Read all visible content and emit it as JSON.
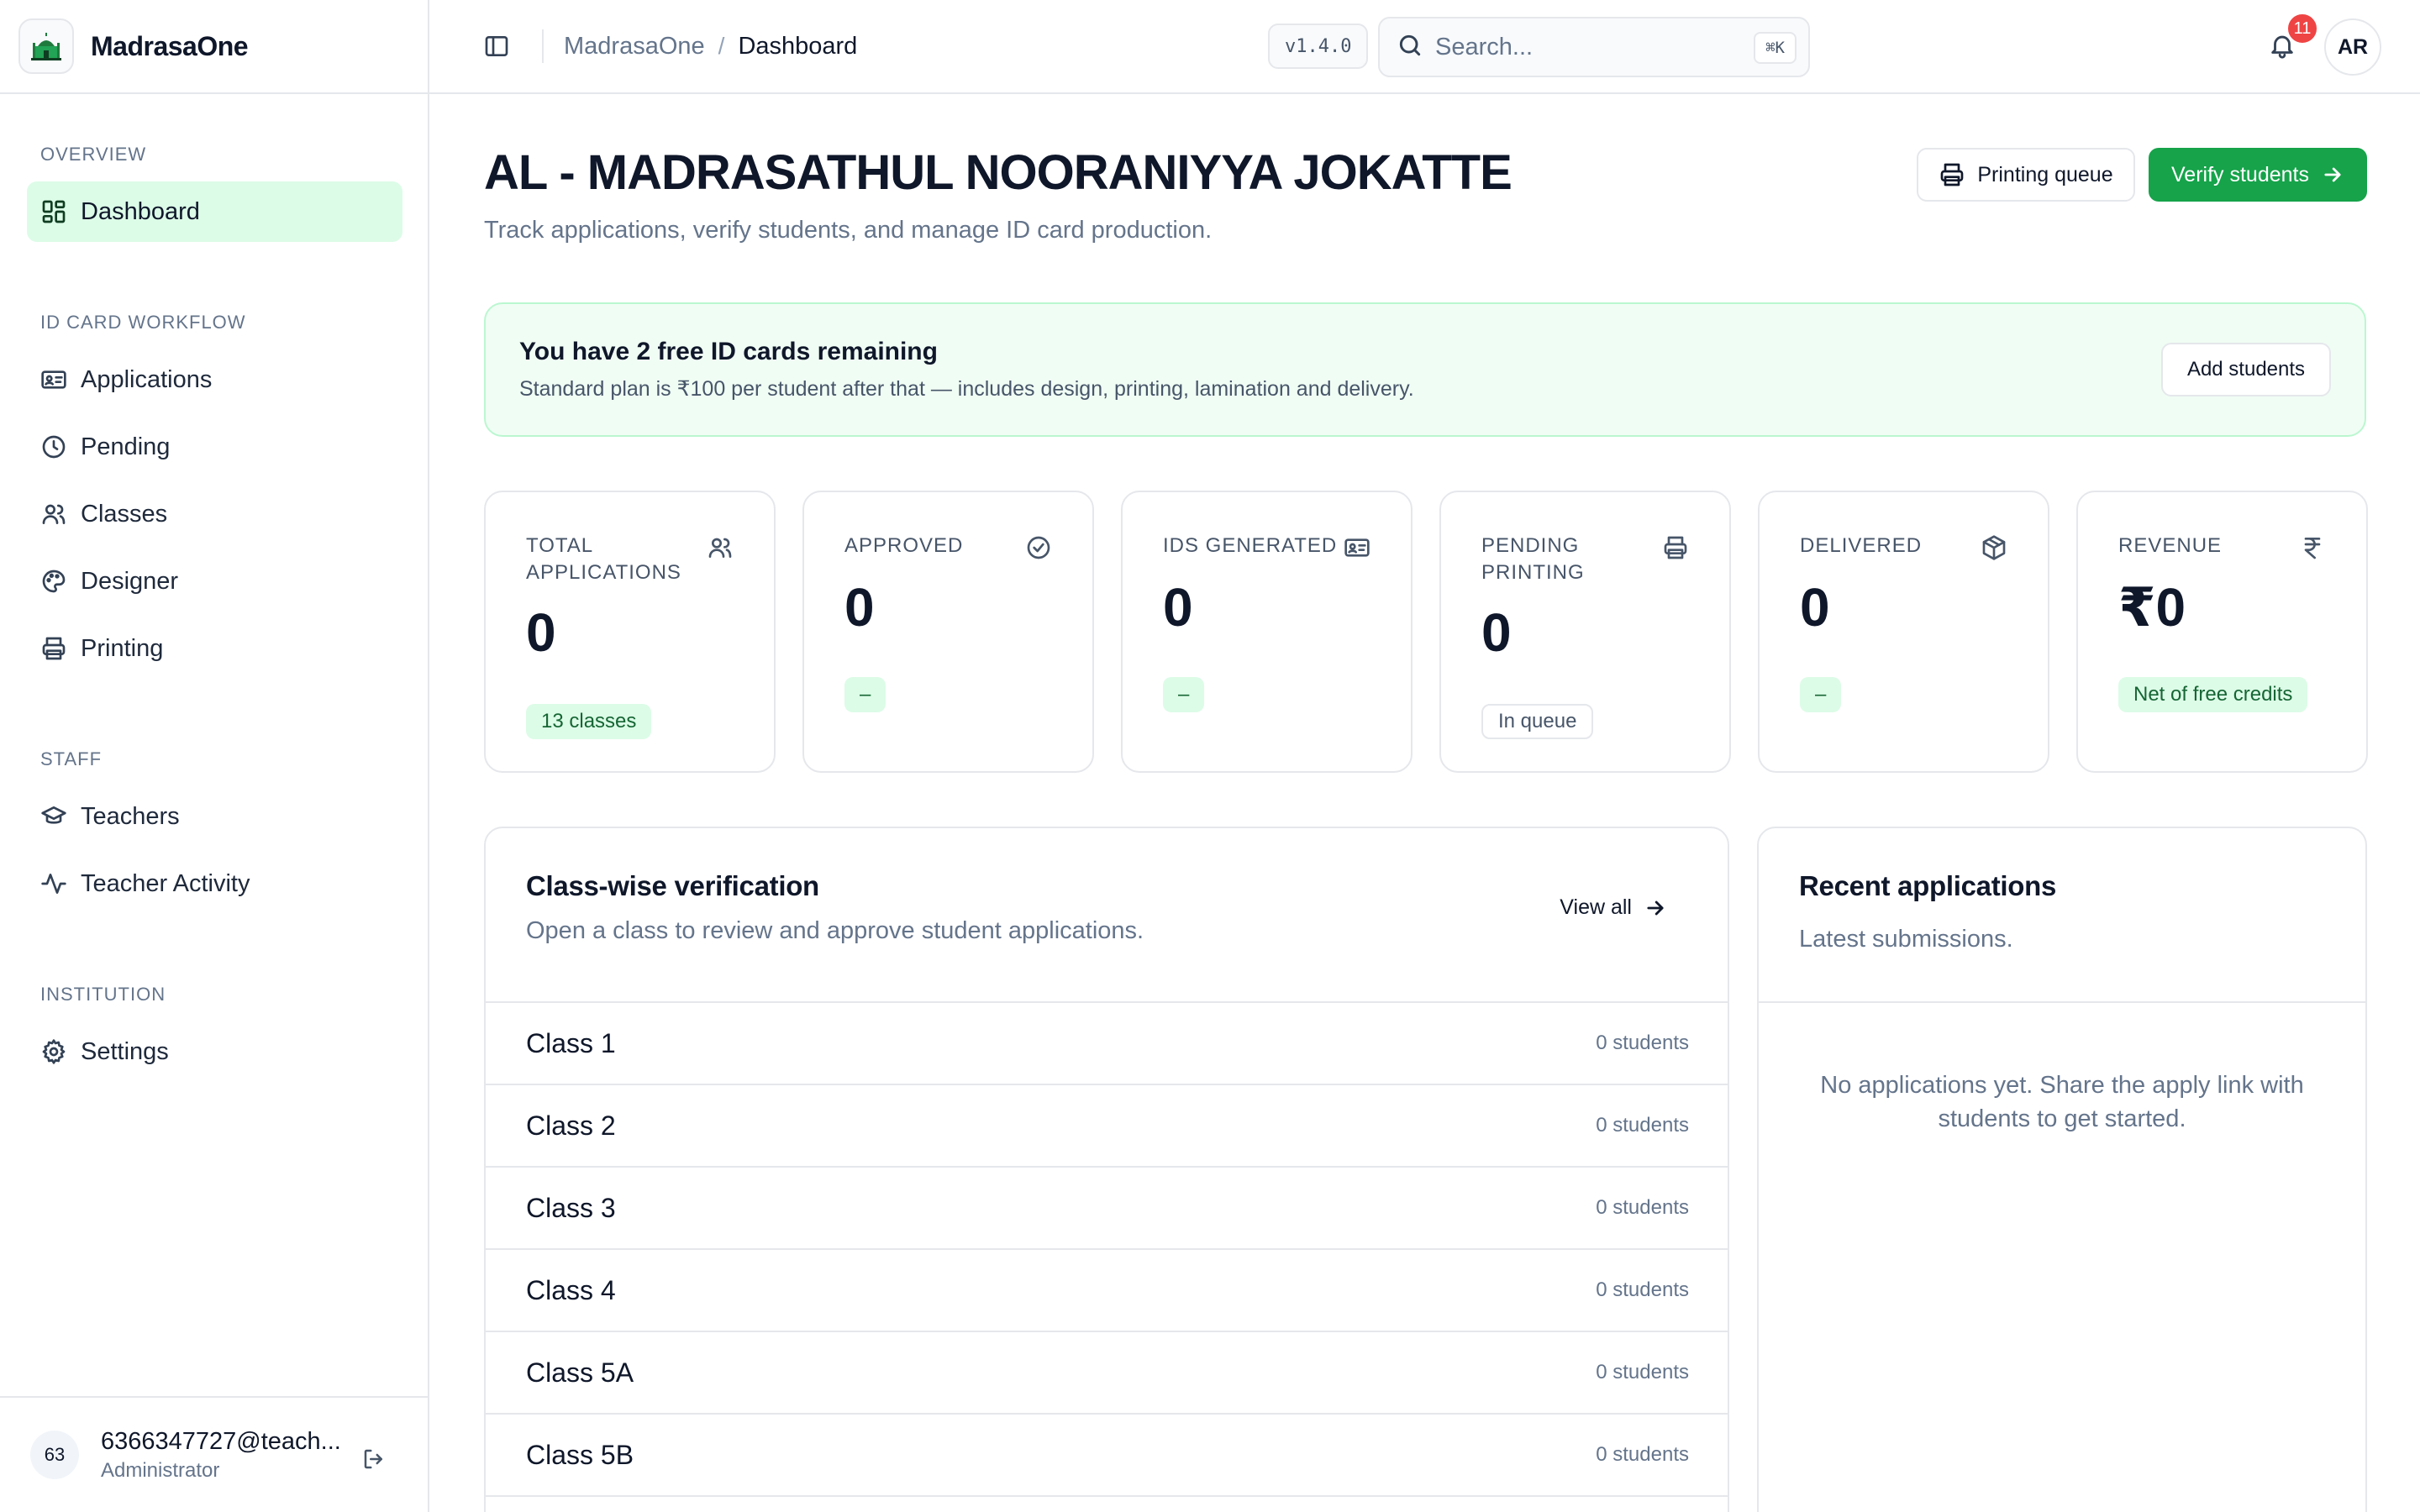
{
  "brand": {
    "name": "MadrasaOne"
  },
  "sidebar": {
    "sections": [
      {
        "heading": "OVERVIEW",
        "items": [
          {
            "label": "Dashboard",
            "icon": "dashboard-icon"
          }
        ]
      },
      {
        "heading": "ID CARD WORKFLOW",
        "items": [
          {
            "label": "Applications",
            "icon": "id-card-icon"
          },
          {
            "label": "Pending",
            "icon": "clock-icon"
          },
          {
            "label": "Classes",
            "icon": "users-icon"
          },
          {
            "label": "Designer",
            "icon": "palette-icon"
          },
          {
            "label": "Printing",
            "icon": "printer-icon"
          }
        ]
      },
      {
        "heading": "STAFF",
        "items": [
          {
            "label": "Teachers",
            "icon": "graduation-cap-icon"
          },
          {
            "label": "Teacher Activity",
            "icon": "activity-icon"
          }
        ]
      },
      {
        "heading": "INSTITUTION",
        "items": [
          {
            "label": "Settings",
            "icon": "gear-icon"
          }
        ]
      }
    ],
    "active": "Dashboard",
    "user": {
      "initials": "63",
      "email": "6366347727@teach...",
      "role": "Administrator"
    }
  },
  "topbar": {
    "breadcrumb": [
      "MadrasaOne",
      "Dashboard"
    ],
    "version": "v1.4.0",
    "search_placeholder": "Search...",
    "search_shortcut": "⌘K",
    "notification_count": "11",
    "avatar_initials": "AR"
  },
  "header": {
    "title": "AL - MADRASATHUL NOORANIYYA JOKATTE",
    "subtitle": "Track applications, verify students, and manage ID card production.",
    "printing_queue_label": "Printing queue",
    "verify_label": "Verify students"
  },
  "banner": {
    "title": "You have 2 free ID cards remaining",
    "text": "Standard plan is ₹100 per student after that — includes design, printing, lamination and delivery.",
    "button": "Add students"
  },
  "stats": [
    {
      "label": "TOTAL APPLICATIONS",
      "value": "0",
      "chip": "13 classes",
      "icon": "users-icon"
    },
    {
      "label": "APPROVED",
      "value": "0",
      "chip": "–",
      "icon": "check-circle-icon"
    },
    {
      "label": "IDS GENERATED",
      "value": "0",
      "chip": "–",
      "icon": "id-card-icon"
    },
    {
      "label": "PENDING PRINTING",
      "value": "0",
      "chip": "In queue",
      "icon": "printer-icon"
    },
    {
      "label": "DELIVERED",
      "value": "0",
      "chip": "–",
      "icon": "package-icon"
    },
    {
      "label": "REVENUE",
      "value": "₹0",
      "chip": "Net of free credits",
      "icon": "rupee-icon"
    }
  ],
  "class_card": {
    "title": "Class-wise verification",
    "subtitle": "Open a class to review and approve student applications.",
    "view_all": "View all",
    "rows": [
      {
        "name": "Class 1",
        "count": "0 students"
      },
      {
        "name": "Class 2",
        "count": "0 students"
      },
      {
        "name": "Class 3",
        "count": "0 students"
      },
      {
        "name": "Class 4",
        "count": "0 students"
      },
      {
        "name": "Class 5A",
        "count": "0 students"
      },
      {
        "name": "Class 5B",
        "count": "0 students"
      }
    ]
  },
  "recent_card": {
    "title": "Recent applications",
    "subtitle": "Latest submissions.",
    "empty": "No applications yet. Share the apply link with students to get started."
  }
}
